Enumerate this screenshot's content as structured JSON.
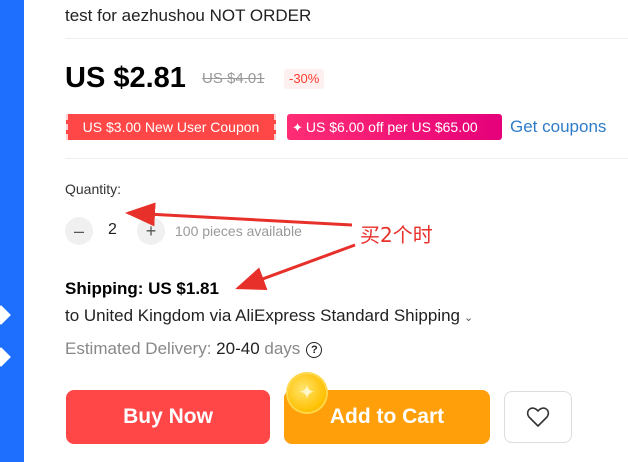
{
  "product": {
    "title": "test for aezhushou NOT ORDER"
  },
  "price": {
    "current": "US $2.81",
    "original": "US $4.01",
    "discount": "-30%"
  },
  "coupons": [
    {
      "label": "US $3.00 New User Coupon"
    },
    {
      "label": "US $6.00 off per US $65.00"
    }
  ],
  "get_coupons_label": "Get coupons",
  "quantity": {
    "label": "Quantity:",
    "value": "2",
    "minus": "–",
    "plus": "+",
    "available": "100 pieces available"
  },
  "annotation": {
    "text": "买2个时",
    "color": "#e8302a"
  },
  "shipping": {
    "price": "Shipping: US $1.81",
    "route": "to United Kingdom via AliExpress Standard Shipping",
    "delivery_label": "Estimated Delivery:",
    "delivery_range": "20-40",
    "delivery_unit": "days"
  },
  "actions": {
    "buy_now": "Buy Now",
    "add_to_cart": "Add to Cart"
  },
  "icons": {
    "help": "question-circle-icon",
    "wishlist": "heart-icon",
    "chevron": "chevron-down-icon",
    "coin": "coin-sparkle-icon"
  },
  "colors": {
    "buy_now": "#ff4747",
    "add_to_cart": "#ff9f0a",
    "link": "#2e7cc9",
    "strip": "#1f6fff"
  }
}
